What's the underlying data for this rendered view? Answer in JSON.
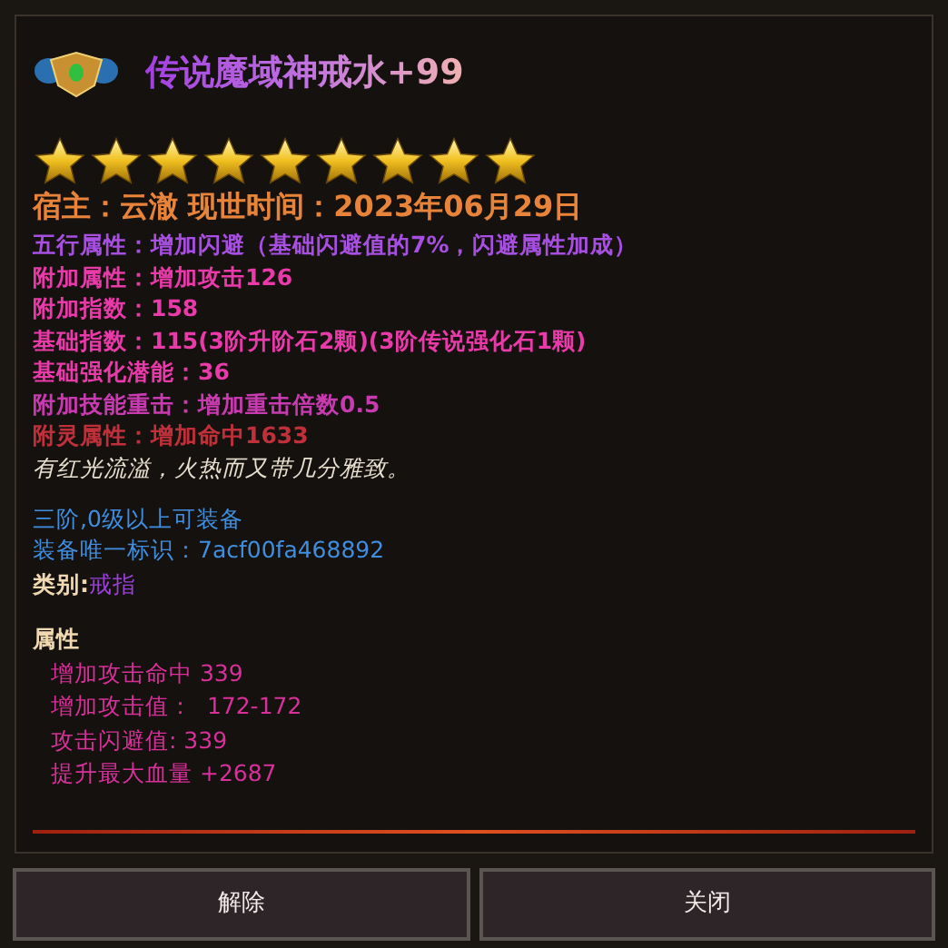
{
  "item": {
    "title": "传说魔域神戒水+99",
    "stars": 9
  },
  "owner_line": "宿主：云澈 现世时间：2023年06月29日",
  "attributes": [
    {
      "text": "五行属性：增加闪避（基础闪避值的7%，闪避属性加成）",
      "color": "#a64fe0"
    },
    {
      "text": "附加属性：增加攻击126",
      "color": "#e83aa8"
    },
    {
      "text": "附加指数：158",
      "color": "#e83aa8"
    },
    {
      "text": "基础指数：115(3阶升阶石2颗)(3阶传说强化石1颗)",
      "color": "#e83aa8"
    },
    {
      "text": "基础强化潜能：36",
      "color": "#e83aa8"
    },
    {
      "text": "附加技能重击：增加重击倍数0.5",
      "color": "#c83ab0"
    },
    {
      "text": "附灵属性：增加命中1633",
      "color": "#c0303a"
    }
  ],
  "description": "有红光流溢，火热而又带几分雅致。",
  "requirements": [
    "三阶,0级以上可装备",
    "装备唯一标识：7acf00fa468892"
  ],
  "category": {
    "label": "类别:",
    "value": "戒指"
  },
  "properties": {
    "heading": "属性",
    "lines": [
      "增加攻击命中 339",
      "增加攻击值：  172-172",
      "攻击闪避值: 339",
      "提升最大血量 +2687"
    ]
  },
  "buttons": [
    "解除",
    "关闭"
  ]
}
